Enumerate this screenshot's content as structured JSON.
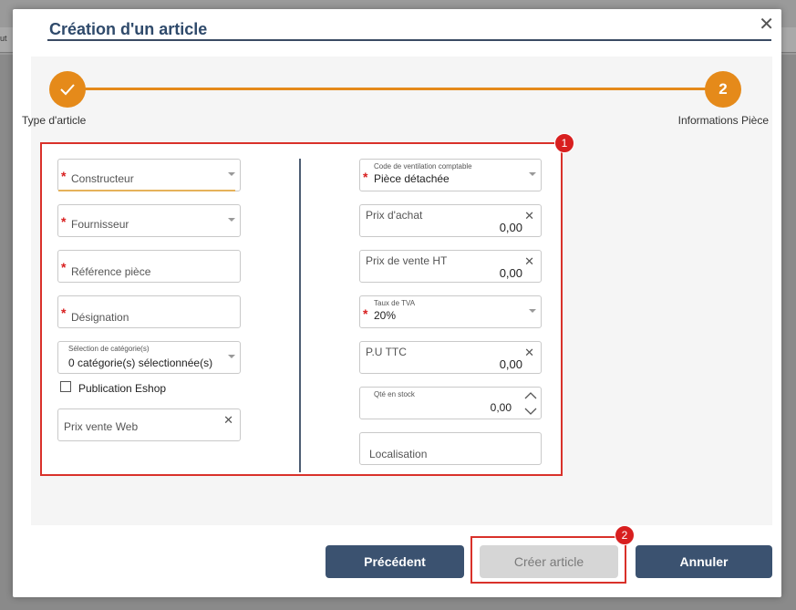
{
  "backdrop": {
    "text": "ut"
  },
  "dialog": {
    "title": "Création d'un article",
    "close_label": "✕"
  },
  "stepper": {
    "step1": {
      "label": "Type d'article",
      "icon": "check-icon"
    },
    "step2": {
      "number": "2",
      "label": "Informations Pièce"
    },
    "color": "#e58a1a"
  },
  "badges": {
    "one": "1",
    "two": "2"
  },
  "left": {
    "constructeur": {
      "placeholder": "Constructeur",
      "required": "*"
    },
    "fournisseur": {
      "placeholder": "Fournisseur",
      "required": "*"
    },
    "reference": {
      "placeholder": "Référence pièce",
      "required": "*"
    },
    "designation": {
      "placeholder": "Désignation",
      "required": "*"
    },
    "categorie": {
      "label": "Sélection de catégorie(s)",
      "value": "0 catégorie(s) sélectionnée(s)"
    },
    "publication": {
      "label": "Publication Eshop"
    },
    "prix_web": {
      "placeholder": "Prix vente Web"
    }
  },
  "right": {
    "ventilation": {
      "label": "Code de ventilation comptable",
      "value": "Pièce détachée",
      "required": "*"
    },
    "prix_achat": {
      "label": "Prix d'achat",
      "value": "0,00"
    },
    "prix_vente": {
      "label": "Prix de vente HT",
      "value": "0,00"
    },
    "tva": {
      "label": "Taux de TVA",
      "value": "20%",
      "required": "*"
    },
    "pu_ttc": {
      "label": "P.U TTC",
      "value": "0,00"
    },
    "qte": {
      "label": "Qté en stock",
      "value": "0,00"
    },
    "localisation": {
      "placeholder": "Localisation"
    }
  },
  "buttons": {
    "precedent": "Précédent",
    "creer": "Créer article",
    "annuler": "Annuler"
  }
}
